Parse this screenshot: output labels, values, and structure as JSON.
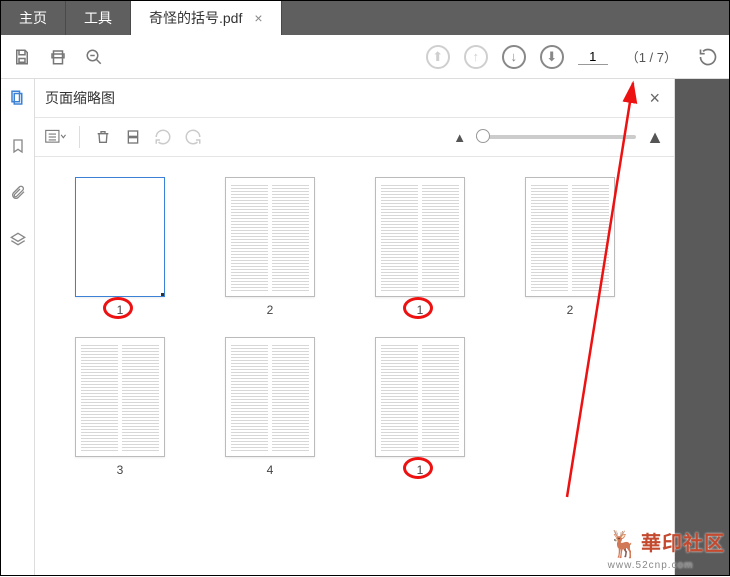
{
  "tabs": {
    "home": "主页",
    "tools": "工具",
    "doc": "奇怪的括号.pdf"
  },
  "toolbar": {
    "page_input": "1",
    "page_count_display": "（1 / 7）"
  },
  "panel": {
    "title": "页面缩略图"
  },
  "thumbnails": [
    {
      "label": "1",
      "selected": true,
      "text": false,
      "circled": true
    },
    {
      "label": "2",
      "selected": false,
      "text": true,
      "twocol": true,
      "circled": false
    },
    {
      "label": "1",
      "selected": false,
      "text": true,
      "twocol": true,
      "circled": true
    },
    {
      "label": "2",
      "selected": false,
      "text": true,
      "twocol": true,
      "circled": false
    },
    {
      "label": "3",
      "selected": false,
      "text": true,
      "twocol": true,
      "circled": false
    },
    {
      "label": "4",
      "selected": false,
      "text": true,
      "twocol": true,
      "circled": false
    },
    {
      "label": "1",
      "selected": false,
      "text": true,
      "twocol": true,
      "circled": true
    }
  ],
  "watermark": {
    "brand": "華印社区",
    "url": "www.52cnp.com"
  }
}
